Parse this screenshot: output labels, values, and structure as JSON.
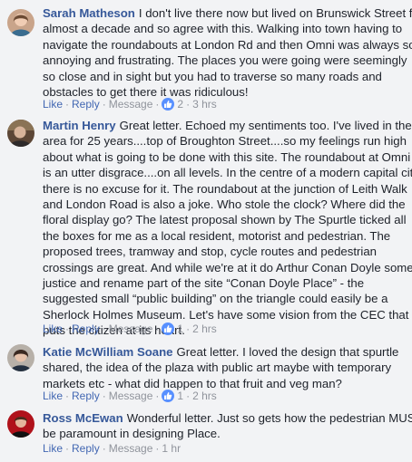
{
  "comments": [
    {
      "author": "Sarah Matheson",
      "lines": [
        "I don't live there now but lived on Brunswick Street for",
        "almost a decade and so agree with this. Walking into town having to",
        "navigate the roundabouts at London Rd and then Omni was always so",
        "annoying and frustrating. The places you were going were seemingly",
        "so close and in sight but you had to traverse so many roads and",
        "obstacles to get there it was ridiculous!"
      ],
      "like_label": "Like",
      "reply_label": "Reply",
      "message_label": "Message",
      "reaction_count": "2",
      "time": "3 hrs"
    },
    {
      "author": "Martin Henry",
      "lines": [
        "Great letter. Echoed my sentiments too. I've lived in the",
        "area for 25 years....top of Broughton Street....so my feelings run high",
        "about what is going to be done with this site. The roundabout at Omni",
        "is an utter disgrace....on all levels. In the centre of a modern capital city",
        "there is no excuse for it. The roundabout at the junction of Leith Walk",
        "and London Road is also a joke. Who stole the clock? Where did the",
        "floral display go? The latest proposal shown by The Spurtle ticked all",
        "the boxes for me as a local resident, motorist and pedestrian. The",
        "proposed trees, tramway and stop, cycle routes and pedestrian",
        "crossings are great. And while we're at it do Arthur Conan Doyle some",
        "justice and rename part of the site “Conan Doyle Place” - the",
        "suggested small “public building” on the triangle could easily be a",
        "Sherlock Holmes Museum. Let's have some vision from the CEC that",
        "puts the citizen at its heart."
      ],
      "like_label": "Like",
      "reply_label": "Reply",
      "message_label": "Message",
      "reaction_count": "1",
      "time": "2 hrs"
    },
    {
      "author": "Katie McWilliam Soane",
      "lines": [
        "Great letter. I loved the design that spurtle",
        "shared, the idea of the plaza with public art maybe with temporary",
        "markets etc - what did happen to that fruit and veg man?"
      ],
      "like_label": "Like",
      "reply_label": "Reply",
      "message_label": "Message",
      "reaction_count": "1",
      "time": "2 hrs"
    },
    {
      "author": "Ross McEwan",
      "lines": [
        "Wonderful letter. Just so gets how the pedestrian MUST",
        "be paramount in designing Place."
      ],
      "like_label": "Like",
      "reply_label": "Reply",
      "message_label": "Message",
      "reaction_count": "",
      "time": "1 hr"
    }
  ],
  "colors": {
    "name": "#365899",
    "link": "#4267b2",
    "muted": "#90949c",
    "like_badge": "#5890ff",
    "background": "#f2f3f5"
  }
}
